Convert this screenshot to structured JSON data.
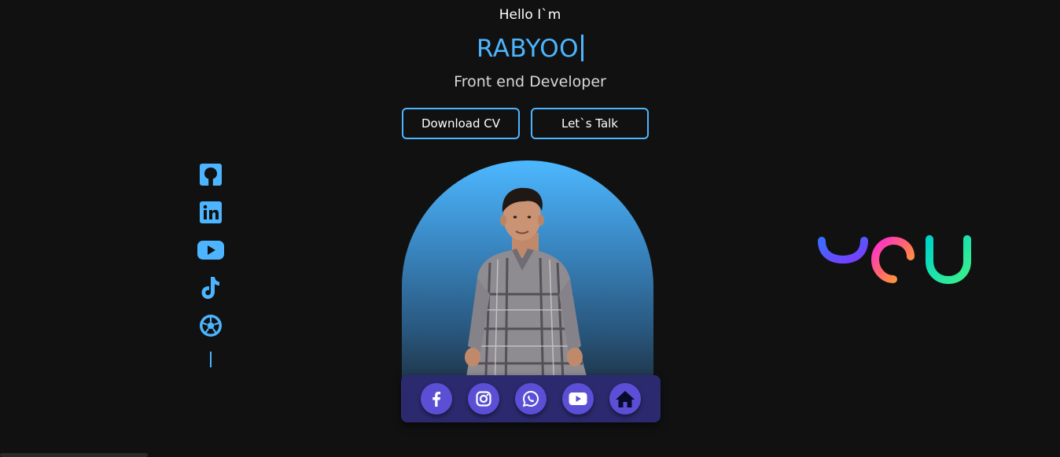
{
  "hero": {
    "greeting": "Hello I`m",
    "name": "RABYOO",
    "role": "Front end Developer"
  },
  "buttons": {
    "download_cv": "Download CV",
    "lets_talk": "Let`s Talk"
  },
  "sidebar_socials": [
    "github-icon",
    "linkedin-icon",
    "youtube-icon",
    "tiktok-icon",
    "soccer-ball-icon"
  ],
  "bottom_nav": [
    "facebook-icon",
    "instagram-icon",
    "whatsapp-icon",
    "youtube-icon",
    "home-icon"
  ],
  "colors": {
    "accent": "#4db5ff",
    "background": "#111111",
    "bottom_bar": "#2c2a6e",
    "nav_circle": "#5b4fd6"
  }
}
